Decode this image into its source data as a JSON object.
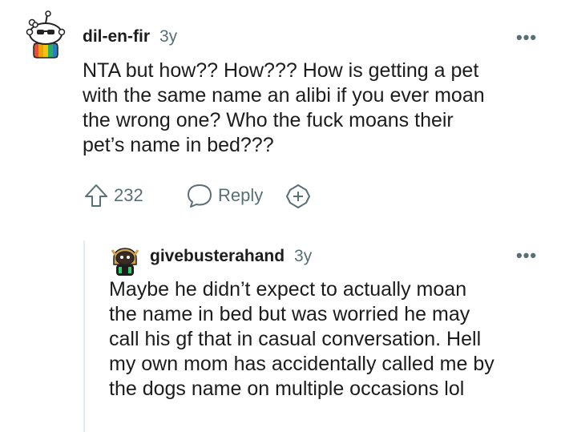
{
  "comment": {
    "username": "dil-en-fir",
    "age": "3y",
    "more_label": "•••",
    "body_lines": [
      "NTA but how?? How??? How is getting a pet",
      "with the same name an alibi if you ever moan",
      "the wrong one? Who the fuck moans their",
      "pet’s name in bed???"
    ],
    "upvotes": "232",
    "reply_label": "Reply",
    "icons": {
      "upvote": "upvote-arrow-icon",
      "reply": "speech-bubble-icon",
      "award": "add-award-icon",
      "avatar": "snoo-avatar-icon"
    }
  },
  "reply": {
    "username": "givebusterahand",
    "age": "3y",
    "more_label": "•••",
    "body_lines": [
      "Maybe he didn’t expect to actually moan",
      "the name in bed but was worried he may",
      "call his gf that in casual conversation. Hell",
      "my own mom has accidentally called me by",
      "the dogs name on multiple occasions lol"
    ]
  },
  "colors": {
    "text": "#1c1c1c",
    "meta": "#576f76",
    "thread_line": "#e5ebee"
  }
}
